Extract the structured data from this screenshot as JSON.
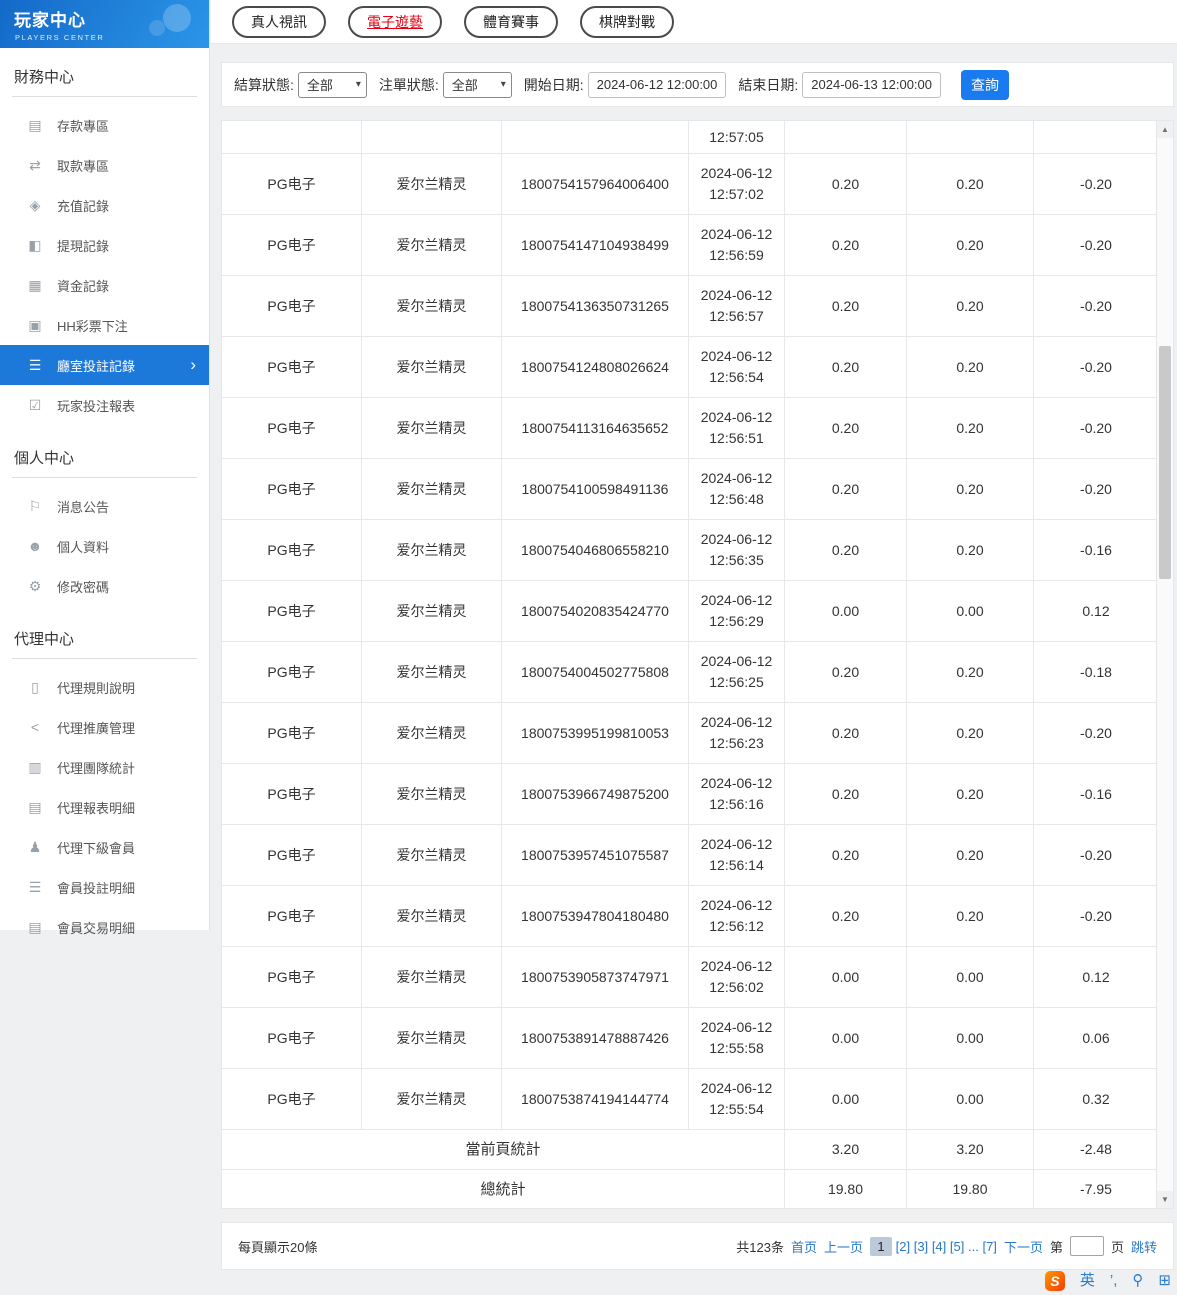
{
  "colors": {
    "accent_blue": "#1d79d9",
    "active_red": "#e60012",
    "link_blue": "#2779c8",
    "button_blue": "#1a7af0"
  },
  "sidebar": {
    "title": "玩家中心",
    "subtitle": "PLAYERS CENTER",
    "sections": [
      {
        "heading": "財務中心",
        "items": [
          {
            "name": "sidebar-item-deposit",
            "label": "存款專區",
            "icon": "deposit-icon",
            "glyph": "▤"
          },
          {
            "name": "sidebar-item-withdraw",
            "label": "取款專區",
            "icon": "withdraw-icon",
            "glyph": "⇄"
          },
          {
            "name": "sidebar-item-recharge-record",
            "label": "充值記錄",
            "icon": "recharge-record-icon",
            "glyph": "◈"
          },
          {
            "name": "sidebar-item-cashout-record",
            "label": "提現記錄",
            "icon": "cashout-record-icon",
            "glyph": "◧"
          },
          {
            "name": "sidebar-item-funds-record",
            "label": "資金記錄",
            "icon": "funds-record-icon",
            "glyph": "▦"
          },
          {
            "name": "sidebar-item-hh-lottery-bet",
            "label": "HH彩票下注",
            "icon": "lottery-bet-icon",
            "glyph": "▣"
          },
          {
            "name": "sidebar-item-room-bet-record",
            "label": "廳室投註記錄",
            "icon": "room-bet-record-icon",
            "glyph": "☰",
            "active": true
          },
          {
            "name": "sidebar-item-player-bet-report",
            "label": "玩家投注報表",
            "icon": "player-bet-report-icon",
            "glyph": "☑"
          }
        ]
      },
      {
        "heading": "個人中心",
        "items": [
          {
            "name": "sidebar-item-announcements",
            "label": "消息公告",
            "icon": "announcement-bell-icon",
            "glyph": "⚐"
          },
          {
            "name": "sidebar-item-profile",
            "label": "個人資料",
            "icon": "user-profile-icon",
            "glyph": "☻"
          },
          {
            "name": "sidebar-item-change-password",
            "label": "修改密碼",
            "icon": "gear-icon",
            "glyph": "⚙"
          }
        ]
      },
      {
        "heading": "代理中心",
        "items": [
          {
            "name": "sidebar-item-agent-rules",
            "label": "代理規則說明",
            "icon": "document-icon",
            "glyph": "▯"
          },
          {
            "name": "sidebar-item-agent-promotion",
            "label": "代理推廣管理",
            "icon": "share-icon",
            "glyph": "<"
          },
          {
            "name": "sidebar-item-agent-team-stats",
            "label": "代理團隊統計",
            "icon": "stats-icon",
            "glyph": "▥"
          },
          {
            "name": "sidebar-item-agent-report-detail",
            "label": "代理報表明細",
            "icon": "report-icon",
            "glyph": "▤"
          },
          {
            "name": "sidebar-item-agent-sub-members",
            "label": "代理下級會員",
            "icon": "users-icon",
            "glyph": "♟"
          },
          {
            "name": "sidebar-item-member-bet-detail",
            "label": "會員投註明細",
            "icon": "list-icon",
            "glyph": "☰"
          },
          {
            "name": "sidebar-item-member-trade-detail",
            "label": "會員交易明細",
            "icon": "ledger-icon",
            "glyph": "▤"
          }
        ]
      }
    ]
  },
  "tabs": [
    {
      "name": "tab-live-casino",
      "label": "真人視訊",
      "active": false
    },
    {
      "name": "tab-electronic-games",
      "label": "電子遊藝",
      "active": true
    },
    {
      "name": "tab-sports",
      "label": "體育賽事",
      "active": false
    },
    {
      "name": "tab-board-games",
      "label": "棋牌對戰",
      "active": false
    }
  ],
  "filters": {
    "settle_status_label": "結算狀態:",
    "settle_status_value": "全部",
    "order_status_label": "注單狀態:",
    "order_status_value": "全部",
    "start_date_label": "開始日期:",
    "start_date_value": "2024-06-12 12:00:00",
    "end_date_label": "結束日期:",
    "end_date_value": "2024-06-13 12:00:00",
    "search_button": "查詢"
  },
  "table": {
    "partial_row_time": "12:57:05",
    "rows": [
      {
        "platform": "PG电子",
        "game": "爱尔兰精灵",
        "order": "1800754157964006400",
        "date": "2024-06-12",
        "time": "12:57:02",
        "bet": "0.20",
        "valid": "0.20",
        "profit": "-0.20"
      },
      {
        "platform": "PG电子",
        "game": "爱尔兰精灵",
        "order": "1800754147104938499",
        "date": "2024-06-12",
        "time": "12:56:59",
        "bet": "0.20",
        "valid": "0.20",
        "profit": "-0.20"
      },
      {
        "platform": "PG电子",
        "game": "爱尔兰精灵",
        "order": "1800754136350731265",
        "date": "2024-06-12",
        "time": "12:56:57",
        "bet": "0.20",
        "valid": "0.20",
        "profit": "-0.20"
      },
      {
        "platform": "PG电子",
        "game": "爱尔兰精灵",
        "order": "1800754124808026624",
        "date": "2024-06-12",
        "time": "12:56:54",
        "bet": "0.20",
        "valid": "0.20",
        "profit": "-0.20"
      },
      {
        "platform": "PG电子",
        "game": "爱尔兰精灵",
        "order": "1800754113164635652",
        "date": "2024-06-12",
        "time": "12:56:51",
        "bet": "0.20",
        "valid": "0.20",
        "profit": "-0.20"
      },
      {
        "platform": "PG电子",
        "game": "爱尔兰精灵",
        "order": "1800754100598491136",
        "date": "2024-06-12",
        "time": "12:56:48",
        "bet": "0.20",
        "valid": "0.20",
        "profit": "-0.20"
      },
      {
        "platform": "PG电子",
        "game": "爱尔兰精灵",
        "order": "1800754046806558210",
        "date": "2024-06-12",
        "time": "12:56:35",
        "bet": "0.20",
        "valid": "0.20",
        "profit": "-0.16"
      },
      {
        "platform": "PG电子",
        "game": "爱尔兰精灵",
        "order": "1800754020835424770",
        "date": "2024-06-12",
        "time": "12:56:29",
        "bet": "0.00",
        "valid": "0.00",
        "profit": "0.12"
      },
      {
        "platform": "PG电子",
        "game": "爱尔兰精灵",
        "order": "1800754004502775808",
        "date": "2024-06-12",
        "time": "12:56:25",
        "bet": "0.20",
        "valid": "0.20",
        "profit": "-0.18"
      },
      {
        "platform": "PG电子",
        "game": "爱尔兰精灵",
        "order": "1800753995199810053",
        "date": "2024-06-12",
        "time": "12:56:23",
        "bet": "0.20",
        "valid": "0.20",
        "profit": "-0.20"
      },
      {
        "platform": "PG电子",
        "game": "爱尔兰精灵",
        "order": "1800753966749875200",
        "date": "2024-06-12",
        "time": "12:56:16",
        "bet": "0.20",
        "valid": "0.20",
        "profit": "-0.16"
      },
      {
        "platform": "PG电子",
        "game": "爱尔兰精灵",
        "order": "1800753957451075587",
        "date": "2024-06-12",
        "time": "12:56:14",
        "bet": "0.20",
        "valid": "0.20",
        "profit": "-0.20"
      },
      {
        "platform": "PG电子",
        "game": "爱尔兰精灵",
        "order": "1800753947804180480",
        "date": "2024-06-12",
        "time": "12:56:12",
        "bet": "0.20",
        "valid": "0.20",
        "profit": "-0.20"
      },
      {
        "platform": "PG电子",
        "game": "爱尔兰精灵",
        "order": "1800753905873747971",
        "date": "2024-06-12",
        "time": "12:56:02",
        "bet": "0.00",
        "valid": "0.00",
        "profit": "0.12"
      },
      {
        "platform": "PG电子",
        "game": "爱尔兰精灵",
        "order": "1800753891478887426",
        "date": "2024-06-12",
        "time": "12:55:58",
        "bet": "0.00",
        "valid": "0.00",
        "profit": "0.06"
      },
      {
        "platform": "PG电子",
        "game": "爱尔兰精灵",
        "order": "1800753874194144774",
        "date": "2024-06-12",
        "time": "12:55:54",
        "bet": "0.00",
        "valid": "0.00",
        "profit": "0.32"
      }
    ],
    "summary": [
      {
        "label": "當前頁統計",
        "bet": "3.20",
        "valid": "3.20",
        "profit": "-2.48"
      },
      {
        "label": "總統計",
        "bet": "19.80",
        "valid": "19.80",
        "profit": "-7.95"
      }
    ]
  },
  "pagination": {
    "page_size_text": "每頁顯示20條",
    "total_text": "共123条",
    "first": "首页",
    "prev": "上一页",
    "pages": [
      {
        "label": "1",
        "current": true
      },
      {
        "label": "[2]"
      },
      {
        "label": "[3]"
      },
      {
        "label": "[4]"
      },
      {
        "label": "[5]"
      },
      {
        "label": "..."
      },
      {
        "label": "[7]"
      }
    ],
    "next": "下一页",
    "jump_prefix": "第",
    "jump_suffix": "页",
    "jump_button": "跳转"
  },
  "ime": {
    "items": [
      {
        "name": "sogou-logo-icon",
        "text": "S",
        "cls": "slogo"
      },
      {
        "name": "input-language-icon",
        "text": "英",
        "cls": ""
      },
      {
        "name": "punctuation-icon",
        "text": "’,",
        "cls": ""
      },
      {
        "name": "voice-input-icon",
        "text": "⚲",
        "cls": ""
      },
      {
        "name": "soft-keyboard-icon",
        "text": "⊞",
        "cls": ""
      }
    ]
  }
}
